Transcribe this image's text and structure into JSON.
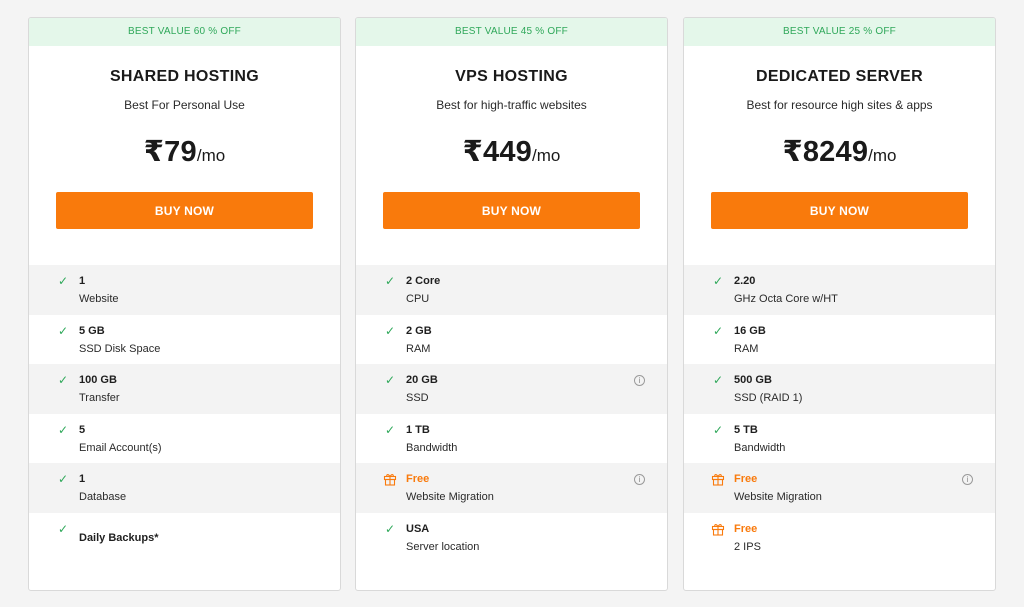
{
  "plans": [
    {
      "badge": "BEST VALUE 60 % OFF",
      "title": "SHARED HOSTING",
      "subtitle": "Best For Personal Use",
      "price": "₹79",
      "period": "/mo",
      "button_label": "BUY NOW",
      "features": [
        {
          "value": "1",
          "label": "Website",
          "icon": "check-icon"
        },
        {
          "value": "5 GB",
          "label": "SSD Disk Space",
          "icon": "check-icon"
        },
        {
          "value": "100 GB",
          "label": "Transfer",
          "icon": "check-icon"
        },
        {
          "value": "5",
          "label": "Email Account(s)",
          "icon": "check-icon"
        },
        {
          "value": "1",
          "label": "Database",
          "icon": "check-icon"
        },
        {
          "value": "Daily Backups*",
          "label": "",
          "icon": "check-icon"
        }
      ]
    },
    {
      "badge": "BEST VALUE 45 % OFF",
      "title": "VPS HOSTING",
      "subtitle": "Best for high-traffic websites",
      "price": "₹449",
      "period": "/mo",
      "button_label": "BUY NOW",
      "features": [
        {
          "value": "2 Core",
          "label": "CPU",
          "icon": "check-icon"
        },
        {
          "value": "2 GB",
          "label": "RAM",
          "icon": "check-icon"
        },
        {
          "value": "20 GB",
          "label": "SSD",
          "icon": "check-icon",
          "info": true
        },
        {
          "value": "1 TB",
          "label": "Bandwidth",
          "icon": "check-icon"
        },
        {
          "value": "Free",
          "label": "Website Migration",
          "icon": "gift-icon",
          "info": true
        },
        {
          "value": "USA",
          "label": "Server location",
          "icon": "check-icon"
        }
      ]
    },
    {
      "badge": "BEST VALUE 25 % OFF",
      "title": "DEDICATED SERVER",
      "subtitle": "Best for resource high sites & apps",
      "price": "₹8249",
      "period": "/mo",
      "button_label": "BUY NOW",
      "features": [
        {
          "value": "2.20",
          "label": "GHz Octa Core w/HT",
          "icon": "check-icon"
        },
        {
          "value": "16 GB",
          "label": "RAM",
          "icon": "check-icon"
        },
        {
          "value": "500 GB",
          "label": "SSD (RAID 1)",
          "icon": "check-icon"
        },
        {
          "value": "5 TB",
          "label": "Bandwidth",
          "icon": "check-icon"
        },
        {
          "value": "Free",
          "label": "Website Migration",
          "icon": "gift-icon",
          "info": true
        },
        {
          "value": "Free",
          "label": "2 IPS",
          "icon": "gift-icon"
        }
      ]
    }
  ],
  "colors": {
    "accent": "#f97a0c",
    "badge_text": "#2fa85a",
    "badge_bg": "#e4f7ea",
    "check": "#2fa85a"
  }
}
